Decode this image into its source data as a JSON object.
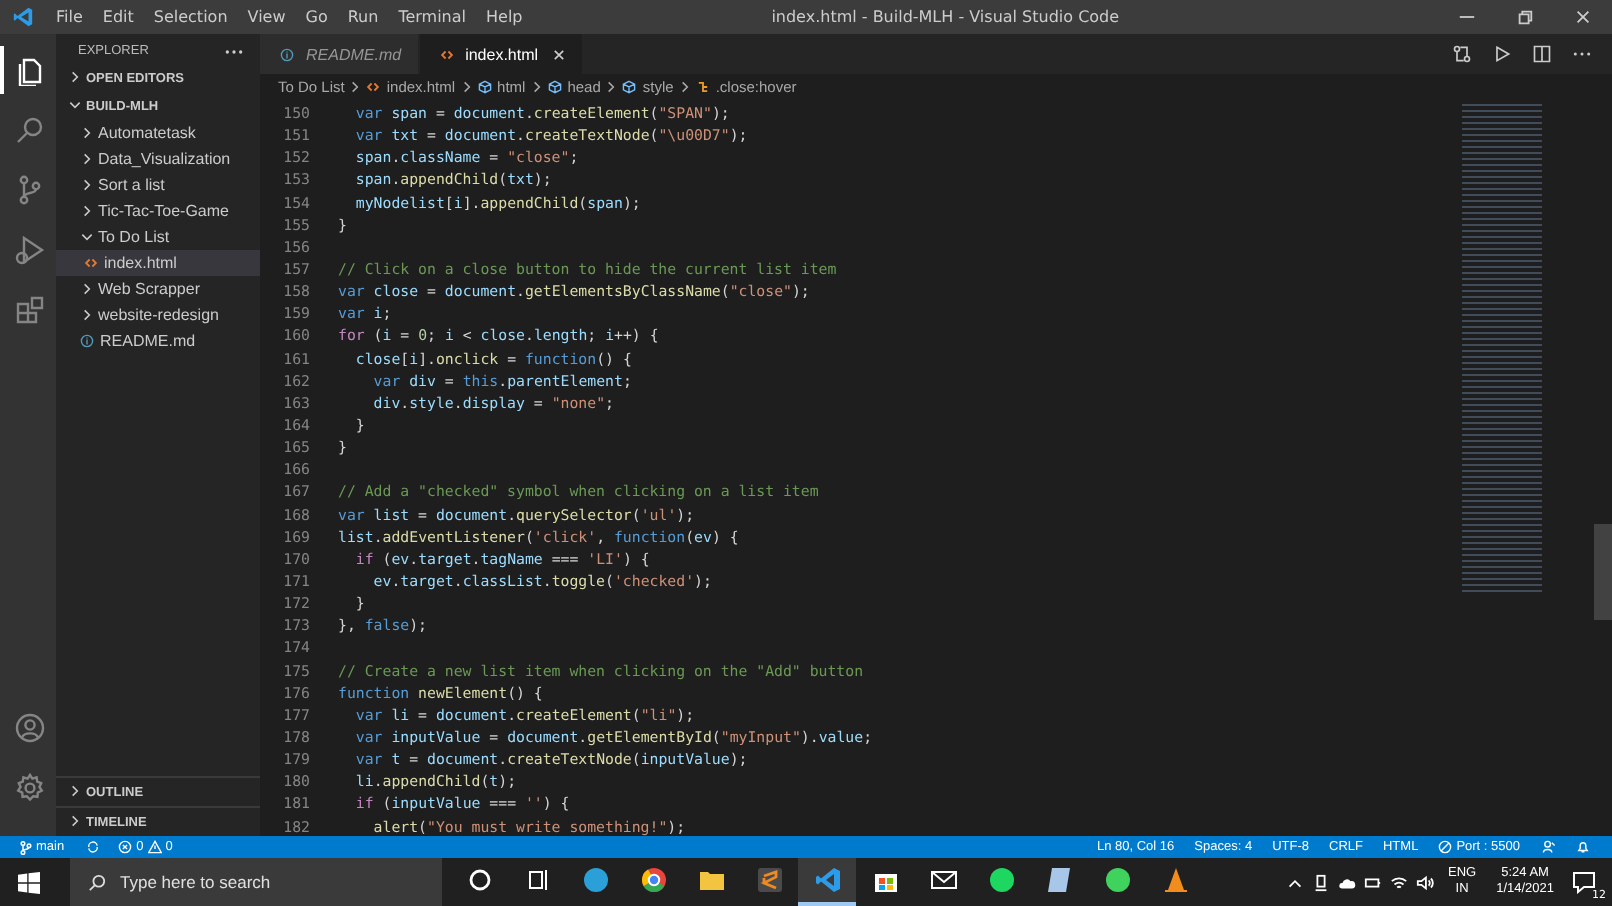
{
  "window": {
    "menu": [
      "File",
      "Edit",
      "Selection",
      "View",
      "Go",
      "Run",
      "Terminal",
      "Help"
    ],
    "title": "index.html - Build-MLH - Visual Studio Code"
  },
  "activity_bar": [
    {
      "kind": "files",
      "selected": true
    },
    {
      "kind": "search",
      "selected": false
    },
    {
      "kind": "source-control",
      "selected": false
    },
    {
      "kind": "run",
      "selected": false
    },
    {
      "kind": "extensions",
      "selected": false
    }
  ],
  "sidebar": {
    "title": "EXPLORER",
    "sections": [
      {
        "label": "OPEN EDITORS",
        "expanded": false
      },
      {
        "label": "BUILD-MLH",
        "expanded": true
      }
    ],
    "items": [
      {
        "label": "Automatetask",
        "kind": "folder",
        "expanded": false,
        "selected": false
      },
      {
        "label": "Data_Visualization",
        "kind": "folder",
        "expanded": false,
        "selected": false
      },
      {
        "label": "Sort a list",
        "kind": "folder",
        "expanded": false,
        "selected": false
      },
      {
        "label": "Tic-Tac-Toe-Game",
        "kind": "folder",
        "expanded": false,
        "selected": false
      },
      {
        "label": "To Do List",
        "kind": "folder",
        "expanded": true,
        "selected": false,
        "children": [
          {
            "label": "index.html",
            "kind": "html",
            "selected": true
          }
        ]
      },
      {
        "label": "Web Scrapper",
        "kind": "folder",
        "expanded": false,
        "selected": false
      },
      {
        "label": "website-redesign",
        "kind": "folder",
        "expanded": false,
        "selected": false
      },
      {
        "label": "README.md",
        "kind": "info",
        "selected": false
      }
    ],
    "bottom_sections": [
      {
        "label": "OUTLINE",
        "expanded": false
      },
      {
        "label": "TIMELINE",
        "expanded": false
      }
    ]
  },
  "tabs": [
    {
      "label": "README.md",
      "kind": "info",
      "selected": false
    },
    {
      "label": "index.html",
      "kind": "html",
      "selected": true
    }
  ],
  "breadcrumbs": [
    {
      "label": "To Do List",
      "kind": "folder"
    },
    {
      "label": "index.html",
      "kind": "html"
    },
    {
      "label": "html",
      "kind": "element"
    },
    {
      "label": "head",
      "kind": "element"
    },
    {
      "label": "style",
      "kind": "element"
    },
    {
      "label": ".close:hover",
      "kind": "rule"
    }
  ],
  "code": [
    {
      "n": "150",
      "tokens": [
        {
          "kind": "kw",
          "text": "  var"
        },
        {
          "kind": "id",
          "text": " span"
        },
        {
          "kind": "pl",
          "text": " = "
        },
        {
          "kind": "id",
          "text": "document"
        },
        {
          "kind": "pl",
          "text": "."
        },
        {
          "kind": "fn",
          "text": "createElement"
        },
        {
          "kind": "pl",
          "text": "("
        },
        {
          "kind": "str",
          "text": "\"SPAN\""
        },
        {
          "kind": "pl",
          "text": ");"
        }
      ]
    },
    {
      "n": "151",
      "tokens": [
        {
          "kind": "kw",
          "text": "  var"
        },
        {
          "kind": "id",
          "text": " txt"
        },
        {
          "kind": "pl",
          "text": " = "
        },
        {
          "kind": "id",
          "text": "document"
        },
        {
          "kind": "pl",
          "text": "."
        },
        {
          "kind": "fn",
          "text": "createTextNode"
        },
        {
          "kind": "pl",
          "text": "("
        },
        {
          "kind": "str",
          "text": "\"\\u00D7\""
        },
        {
          "kind": "pl",
          "text": ");"
        }
      ]
    },
    {
      "n": "152",
      "tokens": [
        {
          "kind": "id",
          "text": "  span"
        },
        {
          "kind": "pl",
          "text": "."
        },
        {
          "kind": "id",
          "text": "className"
        },
        {
          "kind": "pl",
          "text": " = "
        },
        {
          "kind": "str",
          "text": "\"close\""
        },
        {
          "kind": "pl",
          "text": ";"
        }
      ]
    },
    {
      "n": "153",
      "tokens": [
        {
          "kind": "id",
          "text": "  span"
        },
        {
          "kind": "pl",
          "text": "."
        },
        {
          "kind": "fn",
          "text": "appendChild"
        },
        {
          "kind": "pl",
          "text": "("
        },
        {
          "kind": "id",
          "text": "txt"
        },
        {
          "kind": "pl",
          "text": ");"
        }
      ]
    },
    {
      "n": "154",
      "tokens": [
        {
          "kind": "id",
          "text": "  myNodelist"
        },
        {
          "kind": "pl",
          "text": "["
        },
        {
          "kind": "id",
          "text": "i"
        },
        {
          "kind": "pl",
          "text": "]."
        },
        {
          "kind": "fn",
          "text": "appendChild"
        },
        {
          "kind": "pl",
          "text": "("
        },
        {
          "kind": "id",
          "text": "span"
        },
        {
          "kind": "pl",
          "text": ");"
        }
      ]
    },
    {
      "n": "155",
      "tokens": [
        {
          "kind": "pl",
          "text": "}"
        }
      ]
    },
    {
      "n": "156"
    },
    {
      "n": "157",
      "tokens": [
        {
          "kind": "cm",
          "text": "// Click on a close button to hide the current list item"
        }
      ]
    },
    {
      "n": "158",
      "tokens": [
        {
          "kind": "kw",
          "text": "var"
        },
        {
          "kind": "id",
          "text": " close"
        },
        {
          "kind": "pl",
          "text": " = "
        },
        {
          "kind": "id",
          "text": "document"
        },
        {
          "kind": "pl",
          "text": "."
        },
        {
          "kind": "fn",
          "text": "getElementsByClassName"
        },
        {
          "kind": "pl",
          "text": "("
        },
        {
          "kind": "str",
          "text": "\"close\""
        },
        {
          "kind": "pl",
          "text": ");"
        }
      ]
    },
    {
      "n": "159",
      "tokens": [
        {
          "kind": "kw",
          "text": "var"
        },
        {
          "kind": "id",
          "text": " i"
        },
        {
          "kind": "pl",
          "text": ";"
        }
      ]
    },
    {
      "n": "160",
      "tokens": [
        {
          "kind": "ctl",
          "text": "for"
        },
        {
          "kind": "pl",
          "text": " ("
        },
        {
          "kind": "id",
          "text": "i"
        },
        {
          "kind": "pl",
          "text": " = "
        },
        {
          "kind": "num",
          "text": "0"
        },
        {
          "kind": "pl",
          "text": "; "
        },
        {
          "kind": "id",
          "text": "i"
        },
        {
          "kind": "pl",
          "text": " < "
        },
        {
          "kind": "id",
          "text": "close"
        },
        {
          "kind": "pl",
          "text": "."
        },
        {
          "kind": "id",
          "text": "length"
        },
        {
          "kind": "pl",
          "text": "; "
        },
        {
          "kind": "id",
          "text": "i"
        },
        {
          "kind": "pl",
          "text": "++) {"
        }
      ]
    },
    {
      "n": "161",
      "tokens": [
        {
          "kind": "id",
          "text": "  close"
        },
        {
          "kind": "pl",
          "text": "["
        },
        {
          "kind": "id",
          "text": "i"
        },
        {
          "kind": "pl",
          "text": "]."
        },
        {
          "kind": "fn",
          "text": "onclick"
        },
        {
          "kind": "pl",
          "text": " = "
        },
        {
          "kind": "kw",
          "text": "function"
        },
        {
          "kind": "pl",
          "text": "() {"
        }
      ]
    },
    {
      "n": "162",
      "tokens": [
        {
          "kind": "kw",
          "text": "    var"
        },
        {
          "kind": "id",
          "text": " div"
        },
        {
          "kind": "pl",
          "text": " = "
        },
        {
          "kind": "kw",
          "text": "this"
        },
        {
          "kind": "pl",
          "text": "."
        },
        {
          "kind": "id",
          "text": "parentElement"
        },
        {
          "kind": "pl",
          "text": ";"
        }
      ]
    },
    {
      "n": "163",
      "tokens": [
        {
          "kind": "id",
          "text": "    div"
        },
        {
          "kind": "pl",
          "text": "."
        },
        {
          "kind": "id",
          "text": "style"
        },
        {
          "kind": "pl",
          "text": "."
        },
        {
          "kind": "id",
          "text": "display"
        },
        {
          "kind": "pl",
          "text": " = "
        },
        {
          "kind": "str",
          "text": "\"none\""
        },
        {
          "kind": "pl",
          "text": ";"
        }
      ]
    },
    {
      "n": "164",
      "tokens": [
        {
          "kind": "pl",
          "text": "  }"
        }
      ]
    },
    {
      "n": "165",
      "tokens": [
        {
          "kind": "pl",
          "text": "}"
        }
      ]
    },
    {
      "n": "166"
    },
    {
      "n": "167",
      "tokens": [
        {
          "kind": "cm",
          "text": "// Add a \"checked\" symbol when clicking on a list item"
        }
      ]
    },
    {
      "n": "168",
      "tokens": [
        {
          "kind": "kw",
          "text": "var"
        },
        {
          "kind": "id",
          "text": " list"
        },
        {
          "kind": "pl",
          "text": " = "
        },
        {
          "kind": "id",
          "text": "document"
        },
        {
          "kind": "pl",
          "text": "."
        },
        {
          "kind": "fn",
          "text": "querySelector"
        },
        {
          "kind": "pl",
          "text": "("
        },
        {
          "kind": "str",
          "text": "'ul'"
        },
        {
          "kind": "pl",
          "text": ");"
        }
      ]
    },
    {
      "n": "169",
      "tokens": [
        {
          "kind": "id",
          "text": "list"
        },
        {
          "kind": "pl",
          "text": "."
        },
        {
          "kind": "fn",
          "text": "addEventListener"
        },
        {
          "kind": "pl",
          "text": "("
        },
        {
          "kind": "str",
          "text": "'click'"
        },
        {
          "kind": "pl",
          "text": ", "
        },
        {
          "kind": "kw",
          "text": "function"
        },
        {
          "kind": "pl",
          "text": "("
        },
        {
          "kind": "id",
          "text": "ev"
        },
        {
          "kind": "pl",
          "text": ") {"
        }
      ]
    },
    {
      "n": "170",
      "tokens": [
        {
          "kind": "ctl",
          "text": "  if"
        },
        {
          "kind": "pl",
          "text": " ("
        },
        {
          "kind": "id",
          "text": "ev"
        },
        {
          "kind": "pl",
          "text": "."
        },
        {
          "kind": "id",
          "text": "target"
        },
        {
          "kind": "pl",
          "text": "."
        },
        {
          "kind": "id",
          "text": "tagName"
        },
        {
          "kind": "pl",
          "text": " === "
        },
        {
          "kind": "str",
          "text": "'LI'"
        },
        {
          "kind": "pl",
          "text": ") {"
        }
      ]
    },
    {
      "n": "171",
      "tokens": [
        {
          "kind": "id",
          "text": "    ev"
        },
        {
          "kind": "pl",
          "text": "."
        },
        {
          "kind": "id",
          "text": "target"
        },
        {
          "kind": "pl",
          "text": "."
        },
        {
          "kind": "id",
          "text": "classList"
        },
        {
          "kind": "pl",
          "text": "."
        },
        {
          "kind": "fn",
          "text": "toggle"
        },
        {
          "kind": "pl",
          "text": "("
        },
        {
          "kind": "str",
          "text": "'checked'"
        },
        {
          "kind": "pl",
          "text": ");"
        }
      ]
    },
    {
      "n": "172",
      "tokens": [
        {
          "kind": "pl",
          "text": "  }"
        }
      ]
    },
    {
      "n": "173",
      "tokens": [
        {
          "kind": "pl",
          "text": "}, "
        },
        {
          "kind": "kw",
          "text": "false"
        },
        {
          "kind": "pl",
          "text": ");"
        }
      ]
    },
    {
      "n": "174"
    },
    {
      "n": "175",
      "tokens": [
        {
          "kind": "cm",
          "text": "// Create a new list item when clicking on the \"Add\" button"
        }
      ]
    },
    {
      "n": "176",
      "tokens": [
        {
          "kind": "kw",
          "text": "function"
        },
        {
          "kind": "fn",
          "text": " newElement"
        },
        {
          "kind": "pl",
          "text": "() {"
        }
      ]
    },
    {
      "n": "177",
      "tokens": [
        {
          "kind": "kw",
          "text": "  var"
        },
        {
          "kind": "id",
          "text": " li"
        },
        {
          "kind": "pl",
          "text": " = "
        },
        {
          "kind": "id",
          "text": "document"
        },
        {
          "kind": "pl",
          "text": "."
        },
        {
          "kind": "fn",
          "text": "createElement"
        },
        {
          "kind": "pl",
          "text": "("
        },
        {
          "kind": "str",
          "text": "\"li\""
        },
        {
          "kind": "pl",
          "text": ");"
        }
      ]
    },
    {
      "n": "178",
      "tokens": [
        {
          "kind": "kw",
          "text": "  var"
        },
        {
          "kind": "id",
          "text": " inputValue"
        },
        {
          "kind": "pl",
          "text": " = "
        },
        {
          "kind": "id",
          "text": "document"
        },
        {
          "kind": "pl",
          "text": "."
        },
        {
          "kind": "fn",
          "text": "getElementById"
        },
        {
          "kind": "pl",
          "text": "("
        },
        {
          "kind": "str",
          "text": "\"myInput\""
        },
        {
          "kind": "pl",
          "text": ")."
        },
        {
          "kind": "id",
          "text": "value"
        },
        {
          "kind": "pl",
          "text": ";"
        }
      ]
    },
    {
      "n": "179",
      "tokens": [
        {
          "kind": "kw",
          "text": "  var"
        },
        {
          "kind": "id",
          "text": " t"
        },
        {
          "kind": "pl",
          "text": " = "
        },
        {
          "kind": "id",
          "text": "document"
        },
        {
          "kind": "pl",
          "text": "."
        },
        {
          "kind": "fn",
          "text": "createTextNode"
        },
        {
          "kind": "pl",
          "text": "("
        },
        {
          "kind": "id",
          "text": "inputValue"
        },
        {
          "kind": "pl",
          "text": ");"
        }
      ]
    },
    {
      "n": "180",
      "tokens": [
        {
          "kind": "id",
          "text": "  li"
        },
        {
          "kind": "pl",
          "text": "."
        },
        {
          "kind": "fn",
          "text": "appendChild"
        },
        {
          "kind": "pl",
          "text": "("
        },
        {
          "kind": "id",
          "text": "t"
        },
        {
          "kind": "pl",
          "text": ");"
        }
      ]
    },
    {
      "n": "181",
      "tokens": [
        {
          "kind": "ctl",
          "text": "  if"
        },
        {
          "kind": "pl",
          "text": " ("
        },
        {
          "kind": "id",
          "text": "inputValue"
        },
        {
          "kind": "pl",
          "text": " === "
        },
        {
          "kind": "str",
          "text": "''"
        },
        {
          "kind": "pl",
          "text": ") {"
        }
      ]
    },
    {
      "n": "182",
      "tokens": [
        {
          "kind": "fn",
          "text": "    alert"
        },
        {
          "kind": "pl",
          "text": "("
        },
        {
          "kind": "str",
          "text": "\"You must write something!\""
        },
        {
          "kind": "pl",
          "text": ");"
        }
      ]
    }
  ],
  "status_bar": {
    "branch": "main",
    "errors": "0",
    "warnings": "0",
    "right": [
      "Ln 80, Col 16",
      "Spaces: 4",
      "UTF-8",
      "CRLF",
      "HTML"
    ],
    "port": "Port : 5500"
  },
  "taskbar": {
    "search": {
      "placeholder": "Type here to search"
    },
    "apps": [
      {
        "kind": "cortana",
        "selected": false
      },
      {
        "kind": "taskview",
        "selected": false
      },
      {
        "kind": "edge",
        "selected": false
      },
      {
        "kind": "chrome",
        "selected": false
      },
      {
        "kind": "explorer",
        "selected": false
      },
      {
        "kind": "sublime",
        "selected": false
      },
      {
        "kind": "vscode",
        "selected": true
      },
      {
        "kind": "store",
        "selected": false
      },
      {
        "kind": "mail",
        "selected": false
      },
      {
        "kind": "spotify",
        "selected": false
      },
      {
        "kind": "notes",
        "selected": false
      },
      {
        "kind": "whatsapp",
        "selected": false
      },
      {
        "kind": "vlc",
        "selected": false
      }
    ],
    "language": "ENG",
    "region": "IN",
    "time": "5:24 AM",
    "date": "1/14/2021",
    "notifications": "12"
  }
}
